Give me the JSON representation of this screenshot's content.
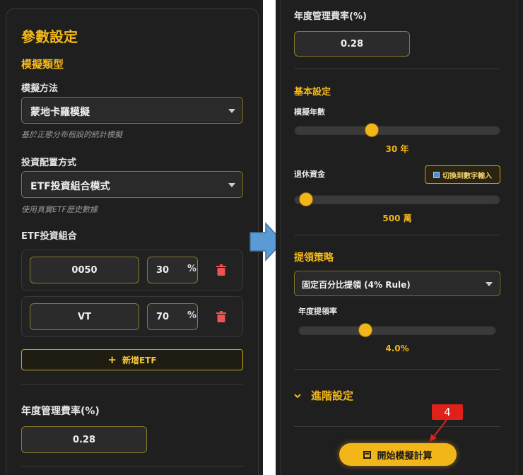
{
  "left": {
    "title": "參數設定",
    "sim_type_heading": "模擬類型",
    "method_label": "模擬方法",
    "method_value": "蒙地卡羅模擬",
    "method_hint": "基於正態分布假設的統計模擬",
    "alloc_label": "投資配置方式",
    "alloc_value": "ETF投資組合模式",
    "alloc_hint": "使用真實ETF歷史數據",
    "portfolio_label": "ETF投資組合",
    "etfs": [
      {
        "ticker": "0050",
        "weight": "30",
        "pct": "%"
      },
      {
        "ticker": "VT",
        "weight": "70",
        "pct": "%"
      }
    ],
    "add_etf_label": "新增ETF",
    "add_etf_icon": "+",
    "fee_label": "年度管理費率(%)",
    "fee_value": "0.28"
  },
  "right": {
    "fee_label": "年度管理費率(%)",
    "fee_value": "0.28",
    "basic_heading": "基本設定",
    "years_label": "模擬年數",
    "years_value": "30 年",
    "years_fraction": 0.37,
    "capital_label": "退休資金",
    "toggle_label": "切換到數字輸入",
    "capital_value": "500 萬",
    "capital_fraction": 0.03,
    "withdraw_heading": "提領策略",
    "strategy_value": "固定百分比提領 (4% Rule)",
    "rate_label": "年度提領率",
    "rate_value": "4.0%",
    "rate_fraction": 0.33,
    "advanced_label": "進階設定",
    "run_label": "開始模擬計算"
  },
  "annotation": {
    "badge": "4"
  },
  "colors": {
    "accent": "#f2b619",
    "panel_bg": "#1d1d1d",
    "danger": "#e0201a",
    "arrow": "#5b9bd5"
  }
}
